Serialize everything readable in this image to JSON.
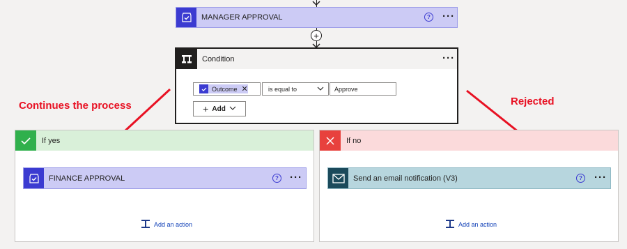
{
  "manager_card": {
    "title": "MANAGER APPROVAL",
    "icon": "approval-icon"
  },
  "condition_card": {
    "title": "Condition",
    "icon": "condition-icon"
  },
  "condition_row": {
    "token_label": "Outcome",
    "operator": "is equal to",
    "value": "Approve"
  },
  "add_button": {
    "label": "Add"
  },
  "annotations": {
    "left": "Continues the process",
    "right": "Rejected"
  },
  "branch_yes": {
    "title": "If yes",
    "action_title": "FINANCE APPROVAL",
    "add_action_label": "Add an action"
  },
  "branch_no": {
    "title": "If no",
    "action_title": "Send an email notification (V3)",
    "add_action_label": "Add an action"
  },
  "colors": {
    "approval_accent": "#3b3bd1",
    "approval_bg": "#cccbf5",
    "condition_bg": "#201f1e",
    "yes_green": "#30b04c",
    "yes_header": "#d9f0d9",
    "no_red": "#e8413d",
    "no_header": "#fbdadb",
    "email_accent": "#1b4a5b",
    "email_bg": "#b7d6de",
    "annotation_red": "#e81123",
    "link_blue": "#0f3fb7"
  }
}
